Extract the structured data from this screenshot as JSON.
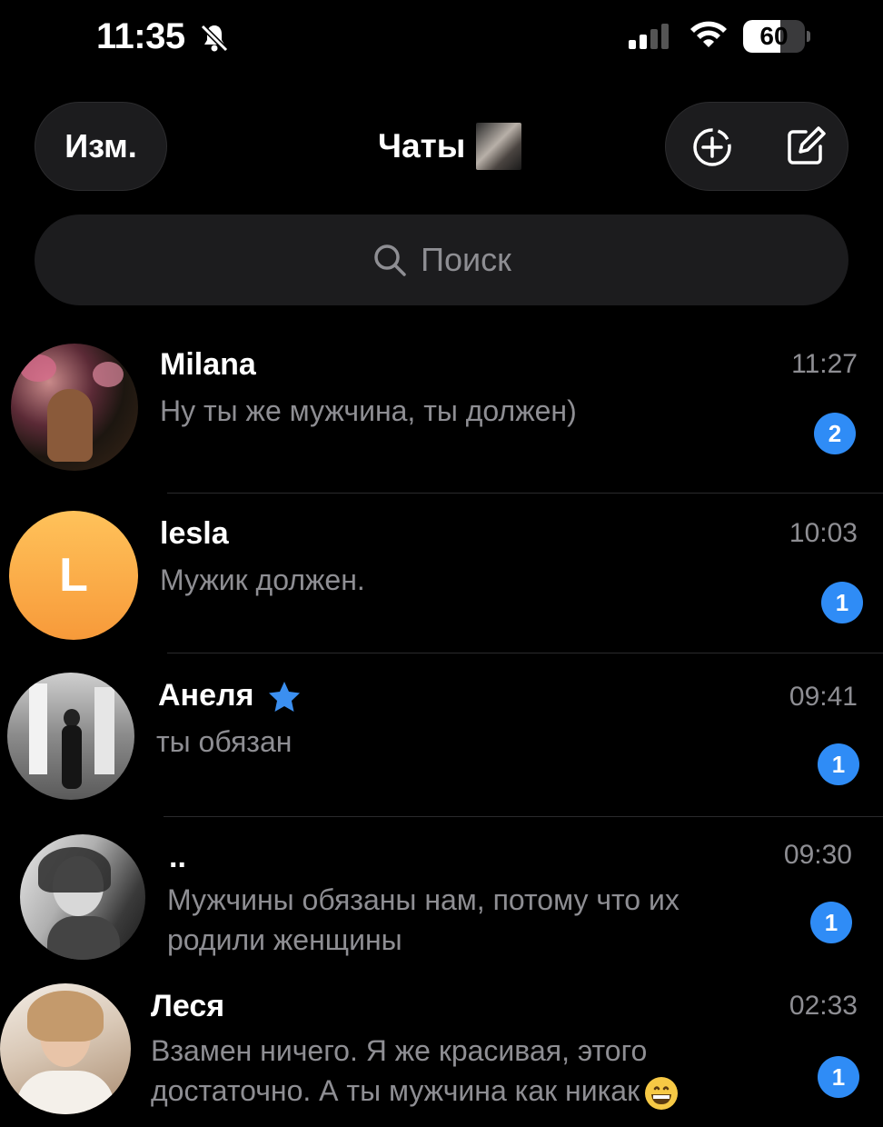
{
  "status_bar": {
    "time": "11:35",
    "battery_level": "60",
    "icons": [
      "bell-slash-icon",
      "signal-icon",
      "wifi-icon",
      "battery-icon"
    ]
  },
  "header": {
    "edit_label": "Изм.",
    "title": "Чаты",
    "icons": [
      "add-circle-icon",
      "compose-icon"
    ]
  },
  "search": {
    "placeholder": "Поиск",
    "icon": "search-icon"
  },
  "chats": [
    {
      "name": "Milana",
      "time": "11:27",
      "message": "Ну ты же мужчина, ты должен)",
      "unread": "2"
    },
    {
      "name": "lesla",
      "time": "10:03",
      "message": "Мужик должен.",
      "unread": "1",
      "avatar_letter": "L"
    },
    {
      "name": "Анеля",
      "time": "09:41",
      "message": "ты обязан",
      "unread": "1",
      "star": true
    },
    {
      "name": "..",
      "time": "09:30",
      "message": "Мужчины обязаны нам, потому что их родили женщины",
      "unread": "1"
    },
    {
      "name": "Леся",
      "time": "02:33",
      "message": "Взамен ничего. Я же красивая, этого достаточно. А ты мужчина как никак",
      "unread": "1",
      "emoji": "grinning-face-icon"
    }
  ],
  "colors": {
    "accent": "#2f8cf6",
    "background": "#000000",
    "surface": "#1c1c1e",
    "secondary_text": "#8e8e93",
    "avatar_orange": "#f79a3a"
  }
}
